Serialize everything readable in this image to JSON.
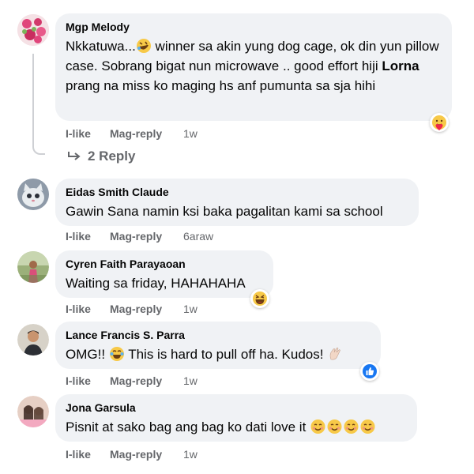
{
  "comments": [
    {
      "author": "Mgp Melody",
      "text_1": "Nkkatuwa...",
      "text_2": " winner sa akin yung dog cage, ok din yun pillow case. Sobrang bigat nun microwave .. good effort hiji ",
      "mention": "Lorna",
      "text_3": " prang na miss ko maging hs anf pumunta sa sja hihi",
      "like": "I-like",
      "reply": "Mag-reply",
      "time": "1w",
      "reaction": "care-reaction-icon",
      "replies_label": "2 Reply"
    },
    {
      "author": "Eidas Smith Claude",
      "text": "Gawin Sana namin ksi baka pagalitan kami sa school",
      "like": "I-like",
      "reply": "Mag-reply",
      "time": "6araw"
    },
    {
      "author": "Cyren Faith Parayaoan",
      "text": "Waiting sa friday, HAHAHAHA",
      "like": "I-like",
      "reply": "Mag-reply",
      "time": "1w",
      "reaction": "haha-reaction-icon"
    },
    {
      "author": "Lance Francis S. Parra",
      "text_1": "OMG!! ",
      "text_2": " This is hard to pull off ha. Kudos! ",
      "like": "I-like",
      "reply": "Mag-reply",
      "time": "1w",
      "reaction": "like-reaction-icon"
    },
    {
      "author": "Jona Garsula",
      "text": "Pisnit at sako bag ang bag ko dati love it ",
      "like": "I-like",
      "reply": "Mag-reply",
      "time": "1w"
    }
  ],
  "colors": {
    "bubble": "#f0f2f5",
    "meta": "#65676b",
    "like_blue": "#1877f2",
    "emoji_yellow": "#f7c948"
  }
}
